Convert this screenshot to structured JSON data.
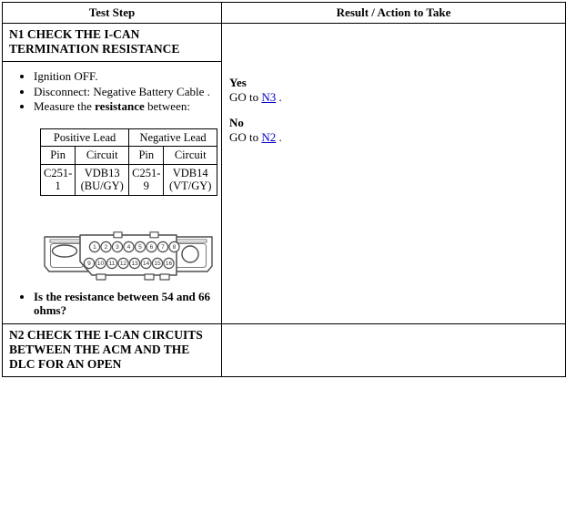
{
  "table": {
    "headers": {
      "test_step": "Test Step",
      "result_action": "Result / Action to Take"
    }
  },
  "steps": [
    {
      "id": "N1",
      "heading": "N1 CHECK THE I-CAN TERMINATION RESISTANCE",
      "actions": [
        "Ignition OFF.",
        "Disconnect: Negative Battery Cable .",
        "Measure the resistance between:"
      ],
      "action3_prefix": "Measure the ",
      "action3_bold": "resistance",
      "action3_suffix": " between:",
      "lead_table": {
        "group_headers": [
          "Positive Lead",
          "Negative Lead"
        ],
        "sub_headers": [
          "Pin",
          "Circuit",
          "Pin",
          "Circuit"
        ],
        "rows": [
          {
            "pos_pin": "C251-1",
            "pos_circuit": "VDB13 (BU/GY)",
            "neg_pin": "C251-9",
            "neg_circuit": "VDB14 (VT/GY)"
          }
        ],
        "cells": {
          "pos_pin_line1": "C251-",
          "pos_pin_line2": "1",
          "pos_circ_line1": "VDB13",
          "pos_circ_line2": "(BU/GY)",
          "neg_pin_line1": "C251-",
          "neg_pin_line2": "9",
          "neg_circ_line1": "VDB14",
          "neg_circ_line2": "(VT/GY)"
        }
      },
      "connector": {
        "name": "dlc-16-pin-connector",
        "top_row_pins": [
          "1",
          "2",
          "3",
          "4",
          "5",
          "6",
          "7",
          "8"
        ],
        "bottom_row_pins": [
          "9",
          "10",
          "11",
          "12",
          "13",
          "14",
          "15",
          "16"
        ]
      },
      "question": "Is the resistance between 54 and 66 ohms?",
      "results": [
        {
          "label": "Yes",
          "text_before": "GO to ",
          "link": "N3",
          "text_after": " ."
        },
        {
          "label": "No",
          "text_before": "GO to ",
          "link": "N2",
          "text_after": " ."
        }
      ]
    },
    {
      "id": "N2",
      "heading": "N2 CHECK THE I-CAN CIRCUITS BETWEEN THE ACM AND THE DLC FOR AN OPEN"
    }
  ],
  "colors": {
    "link": "#0000cc",
    "border": "#000000",
    "text": "#000000",
    "background": "#ffffff"
  }
}
